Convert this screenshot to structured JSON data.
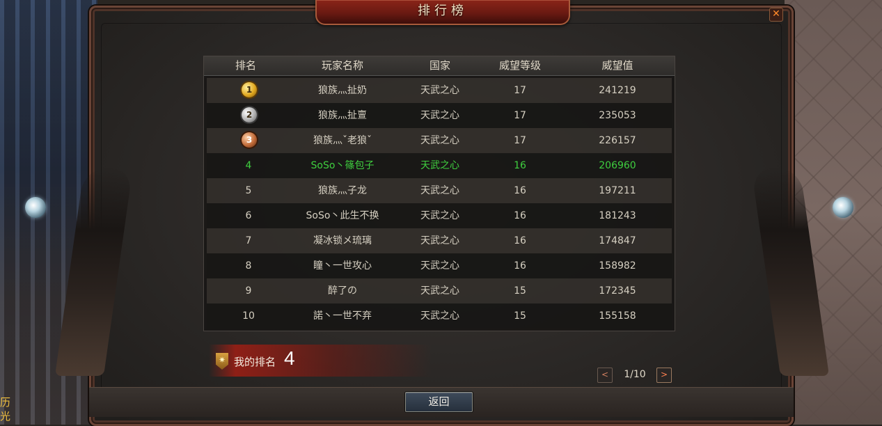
{
  "window": {
    "title": "排行榜",
    "close_icon": "✕"
  },
  "side_text": "历\n光",
  "table": {
    "headers": [
      "排名",
      "玩家名称",
      "国家",
      "威望等级",
      "威望值"
    ],
    "rows": [
      {
        "rank": "1",
        "name": "狼族灬扯奶",
        "country": "天武之心",
        "level": "17",
        "value": "241219",
        "medal": "gold"
      },
      {
        "rank": "2",
        "name": "狼族灬扯亶",
        "country": "天武之心",
        "level": "17",
        "value": "235053",
        "medal": "silver"
      },
      {
        "rank": "3",
        "name": "狼族灬ˇ老狼ˇ",
        "country": "天武之心",
        "level": "17",
        "value": "226157",
        "medal": "bronze"
      },
      {
        "rank": "4",
        "name": "SoSo丶篠包子",
        "country": "天武之心",
        "level": "16",
        "value": "206960",
        "highlight": true
      },
      {
        "rank": "5",
        "name": "狼族灬子龙",
        "country": "天武之心",
        "level": "16",
        "value": "197211"
      },
      {
        "rank": "6",
        "name": "SoSo丶此生不换",
        "country": "天武之心",
        "level": "16",
        "value": "181243"
      },
      {
        "rank": "7",
        "name": "凝冰锁メ琉璃",
        "country": "天武之心",
        "level": "16",
        "value": "174847"
      },
      {
        "rank": "8",
        "name": "瞳丶一世攻心",
        "country": "天武之心",
        "level": "16",
        "value": "158982"
      },
      {
        "rank": "9",
        "name": "醉了の",
        "country": "天武之心",
        "level": "15",
        "value": "172345"
      },
      {
        "rank": "10",
        "name": "諾丶一世不弃",
        "country": "天武之心",
        "level": "15",
        "value": "155158"
      }
    ]
  },
  "my_rank": {
    "label": "我的排名",
    "value": "4"
  },
  "pager": {
    "prev": "<",
    "next": ">",
    "text": "1/10"
  },
  "back_label": "返回",
  "colors": {
    "highlight": "#3fcf3f",
    "title_bg": "#7a1e14",
    "accent": "#ff8a2a"
  }
}
